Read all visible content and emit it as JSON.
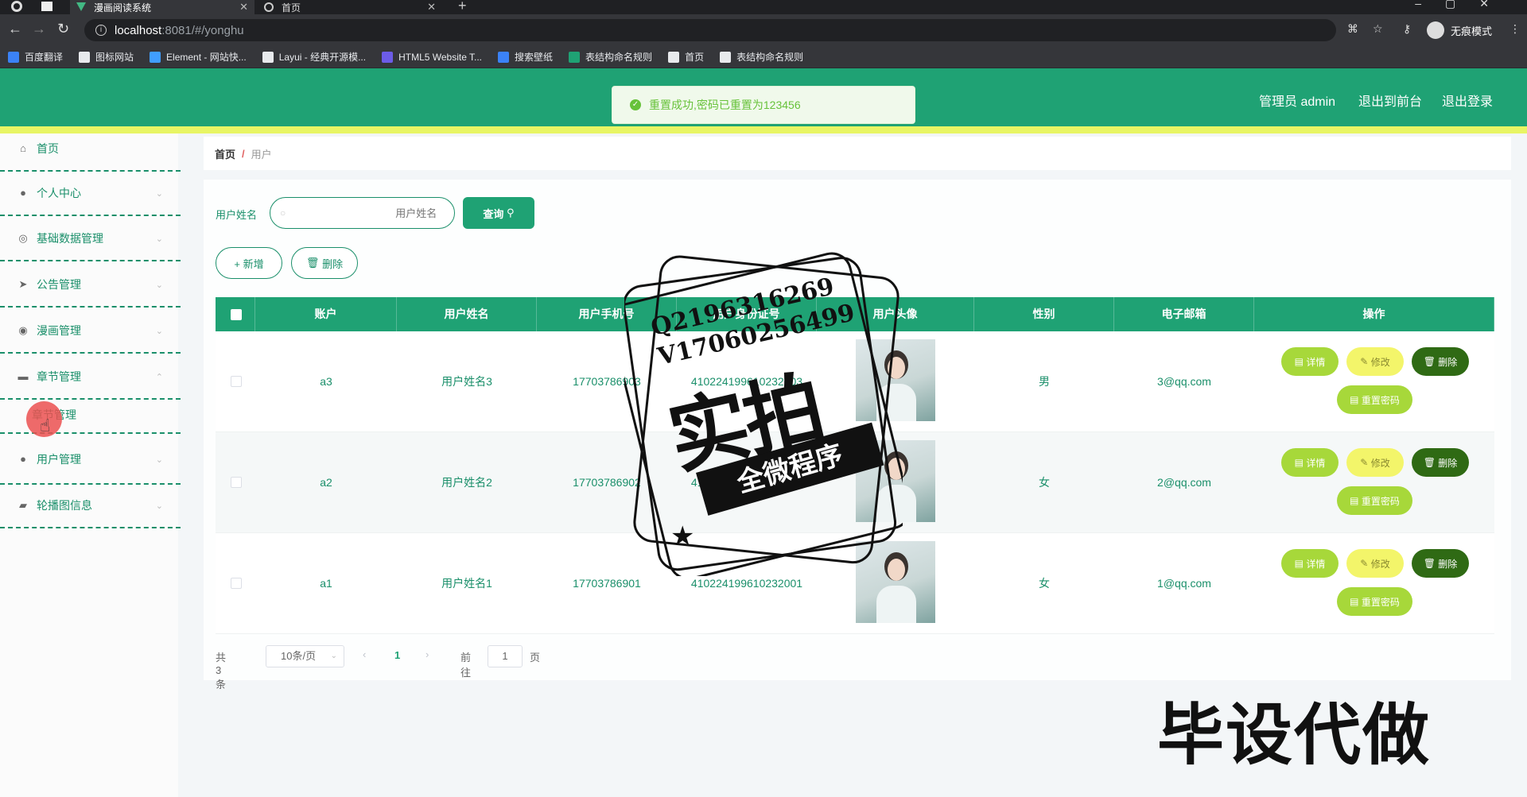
{
  "browser": {
    "tabs": [
      {
        "title": "漫画阅读系统",
        "active": true
      },
      {
        "title": "首页",
        "active": false
      }
    ],
    "url_host": "localhost",
    "url_path": ":8081/#/yonghu",
    "incognito_label": "无痕模式",
    "bookmarks": [
      {
        "label": "百度翻译",
        "icon": "translate-icon",
        "color": "#3b82f6"
      },
      {
        "label": "图标网站",
        "icon": "flag-icon",
        "color": "#e8eaed"
      },
      {
        "label": "Element - 网站快...",
        "icon": "element-icon",
        "color": "#409eff"
      },
      {
        "label": "Layui - 经典开源模...",
        "icon": "layui-icon",
        "color": "#e8eaed"
      },
      {
        "label": "HTML5 Website T...",
        "icon": "html5-icon",
        "color": "#6c5ce7"
      },
      {
        "label": "搜索壁纸",
        "icon": "wallpaper-icon",
        "color": "#3b82f6"
      },
      {
        "label": "表结构命名规则",
        "icon": "sheet-icon",
        "color": "#1fa274"
      },
      {
        "label": "首页",
        "icon": "globe-icon",
        "color": "#e8eaed"
      },
      {
        "label": "表结构命名规则",
        "icon": "globe-icon",
        "color": "#e8eaed"
      }
    ]
  },
  "header": {
    "admin_label": "管理员 admin",
    "link_front": "退出到前台",
    "link_logout": "退出登录",
    "accent": "#1fa274",
    "underline": "#e8f564"
  },
  "toast": {
    "message": "重置成功,密码已重置为123456",
    "color": "#67c23a"
  },
  "sidebar": {
    "items": [
      {
        "label": "首页",
        "icon": "home-icon",
        "glyph": "⌂"
      },
      {
        "label": "个人中心",
        "icon": "user-icon",
        "glyph": "●"
      },
      {
        "label": "基础数据管理",
        "icon": "settings-icon",
        "glyph": "◎"
      },
      {
        "label": "公告管理",
        "icon": "send-icon",
        "glyph": "➤"
      },
      {
        "label": "漫画管理",
        "icon": "compass-icon",
        "glyph": "◉"
      },
      {
        "label": "章节管理",
        "icon": "comment-icon",
        "glyph": "▬"
      },
      {
        "label": "用户管理",
        "icon": "user-icon",
        "glyph": "●"
      },
      {
        "label": "轮播图信息",
        "icon": "folder-icon",
        "glyph": "▰"
      }
    ],
    "submenu_label": "章节管理"
  },
  "breadcrumb": {
    "home": "首页",
    "separator": "/",
    "current": "用户"
  },
  "search": {
    "label": "用户姓名",
    "placeholder": "用户姓名",
    "query_label": "查询"
  },
  "actions": {
    "add_label": "+ 新增",
    "delete_label": "删除"
  },
  "table": {
    "columns": [
      "账户",
      "用户姓名",
      "用户手机号",
      "用户身份证号",
      "用户头像",
      "性别",
      "电子邮箱",
      "操作"
    ],
    "rows": [
      {
        "account": "a3",
        "name": "用户姓名3",
        "phone": "17703786903",
        "idcard": "410224199610232003",
        "gender": "男",
        "email": "3@qq.com"
      },
      {
        "account": "a2",
        "name": "用户姓名2",
        "phone": "17703786902",
        "idcard": "410224199610232002",
        "gender": "女",
        "email": "2@qq.com"
      },
      {
        "account": "a1",
        "name": "用户姓名1",
        "phone": "17703786901",
        "idcard": "410224199610232001",
        "gender": "女",
        "email": "1@qq.com"
      }
    ],
    "btn_detail": "详情",
    "btn_edit": "修改",
    "btn_delete": "删除",
    "btn_reset": "重置密码"
  },
  "pagination": {
    "total": "共 3 条",
    "page_size": "10条/页",
    "current": "1",
    "goto": "前往",
    "goto_value": "1",
    "page_suffix": "页"
  },
  "watermark": {
    "line1": "Q2196316269",
    "line2": "V17060256499",
    "big": "实拍",
    "banner": "全微程序",
    "corner": "毕设代做"
  }
}
